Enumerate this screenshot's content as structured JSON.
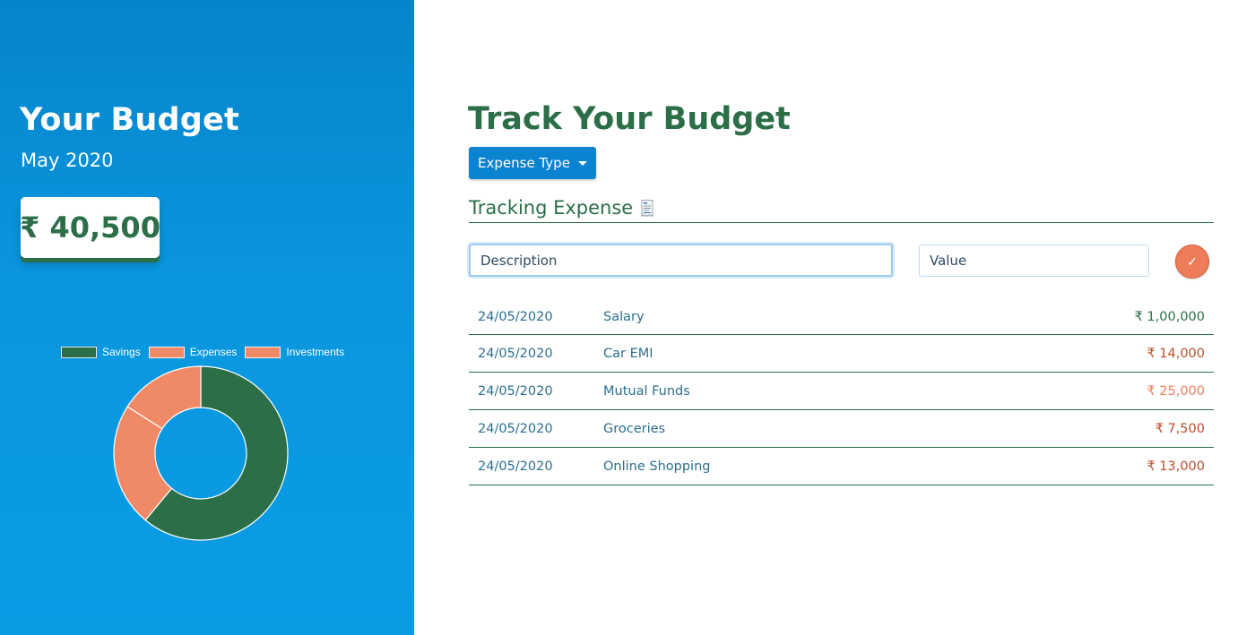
{
  "sidebar": {
    "title": "Your Budget",
    "period": "May 2020",
    "balance": "₹ 40,500",
    "chart_data": {
      "type": "pie",
      "categories": [
        "Savings",
        "Expenses",
        "Investments"
      ],
      "values": [
        61,
        23,
        16
      ],
      "colors": [
        "#2b6e47",
        "#f08a66",
        "#f08a66"
      ],
      "legend": [
        "Savings",
        "Expenses",
        "Investments"
      ],
      "legend_position": "top"
    }
  },
  "main": {
    "title": "Track Your Budget",
    "dropdown_label": "Expense Type",
    "section_title": "Tracking Expense",
    "description_placeholder": "Description",
    "value_placeholder": "Value",
    "submit_label": "✓",
    "transactions": [
      {
        "date": "24/05/2020",
        "description": "Salary",
        "amount": "₹ 1,00,000",
        "kind": "income"
      },
      {
        "date": "24/05/2020",
        "description": "Car EMI",
        "amount": "₹ 14,000",
        "kind": "expense"
      },
      {
        "date": "24/05/2020",
        "description": "Mutual Funds",
        "amount": "₹ 25,000",
        "kind": "investment"
      },
      {
        "date": "24/05/2020",
        "description": "Groceries",
        "amount": "₹ 7,500",
        "kind": "expense"
      },
      {
        "date": "24/05/2020",
        "description": "Online Shopping",
        "amount": "₹ 13,000",
        "kind": "expense"
      }
    ]
  },
  "colors": {
    "brand_green": "#2b6e47",
    "sidebar_blue": "#0a96de",
    "accent_orange": "#ef7c59",
    "dropdown_blue": "#0a83d1"
  }
}
